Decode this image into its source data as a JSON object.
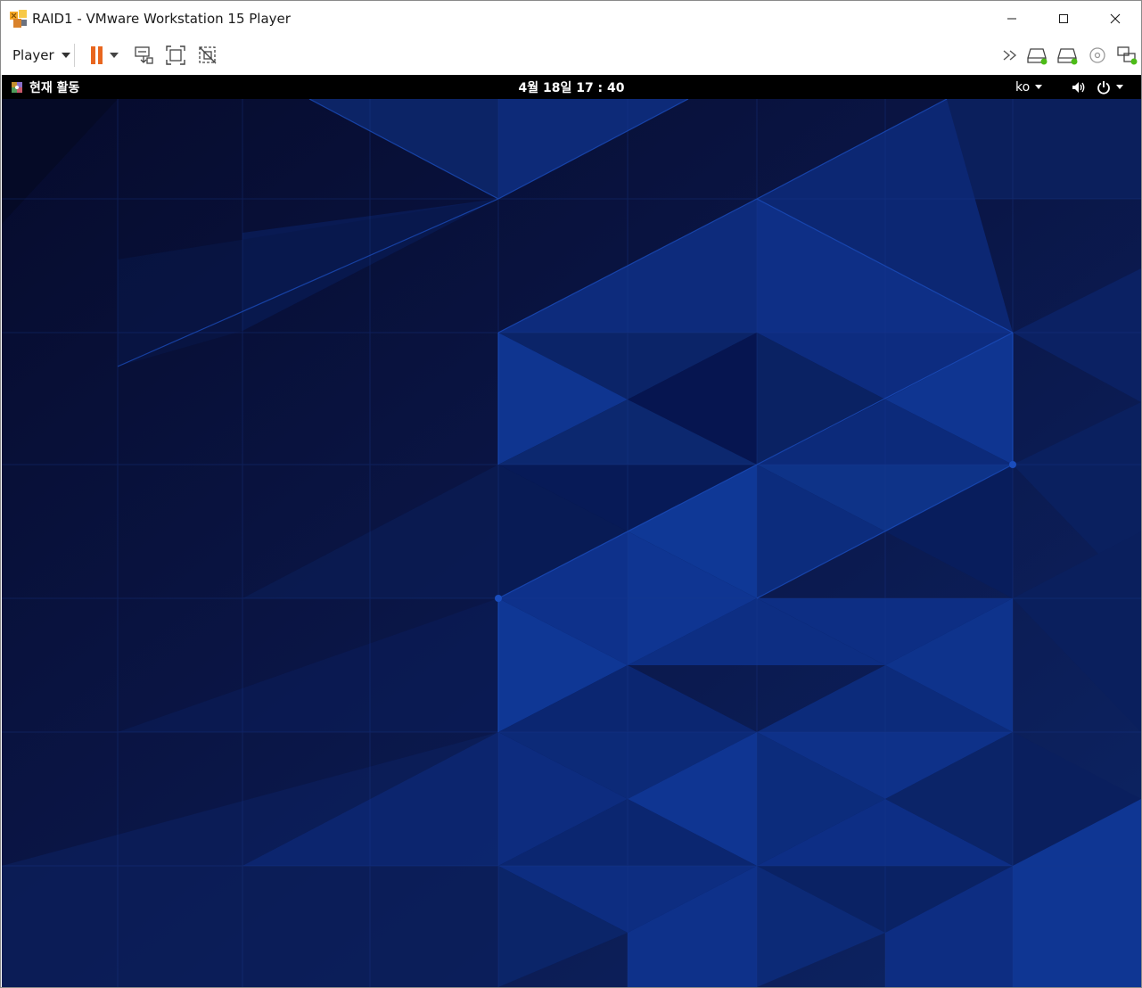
{
  "window": {
    "title": "RAID1 - VMware Workstation 15 Player",
    "controls": {
      "minimize": "minimize",
      "maximize": "maximize",
      "close": "close"
    }
  },
  "toolbar": {
    "player_menu_label": "Player",
    "left_icons": [
      "pause-icon",
      "dropdown-caret-icon",
      "send-ctrl-alt-del-icon",
      "full-screen-icon",
      "unity-icon"
    ],
    "right_icons": [
      "more-devices-icon",
      "hard-disk-icon",
      "hard-disk-2-icon",
      "cd-dvd-icon",
      "network-adapter-icon"
    ],
    "accent_color": "#e8661f",
    "device_active_color": "#4cbb17"
  },
  "guest": {
    "topbar": {
      "activities_label": "현재 활동",
      "clock": "4월 18일 17 : 40",
      "language": "ko",
      "icons": [
        "volume-icon",
        "power-icon"
      ]
    },
    "wallpaper": {
      "base_color": "#0a1240",
      "accent_color": "#0d3a9c"
    }
  }
}
